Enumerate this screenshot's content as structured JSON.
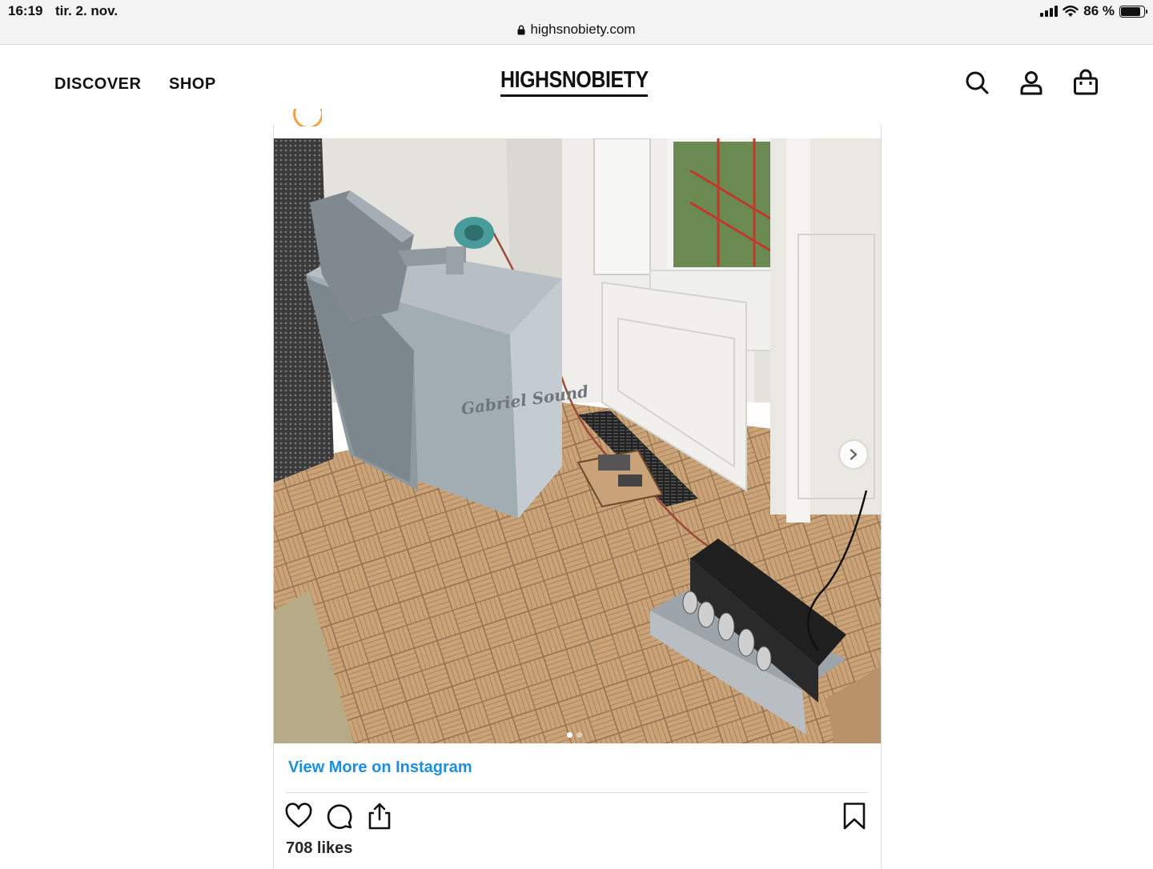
{
  "status_bar": {
    "time": "16:19",
    "date": "tir. 2. nov.",
    "battery": "86 %",
    "battery_level": 0.86,
    "url": "highsnobiety.com"
  },
  "header": {
    "nav": [
      "DISCOVER",
      "SHOP"
    ],
    "logo": "HIGHSNOBIETY",
    "icons": [
      "search-icon",
      "account-icon",
      "bag-icon"
    ]
  },
  "post": {
    "view_more": "View More on Instagram",
    "likes": "708 likes",
    "carousel": {
      "count": 2,
      "active": 1
    },
    "speaker_text": "Gabriel Sound",
    "colors": {
      "link": "#1a8fe3",
      "avatar_ring": "#f7a043"
    }
  }
}
